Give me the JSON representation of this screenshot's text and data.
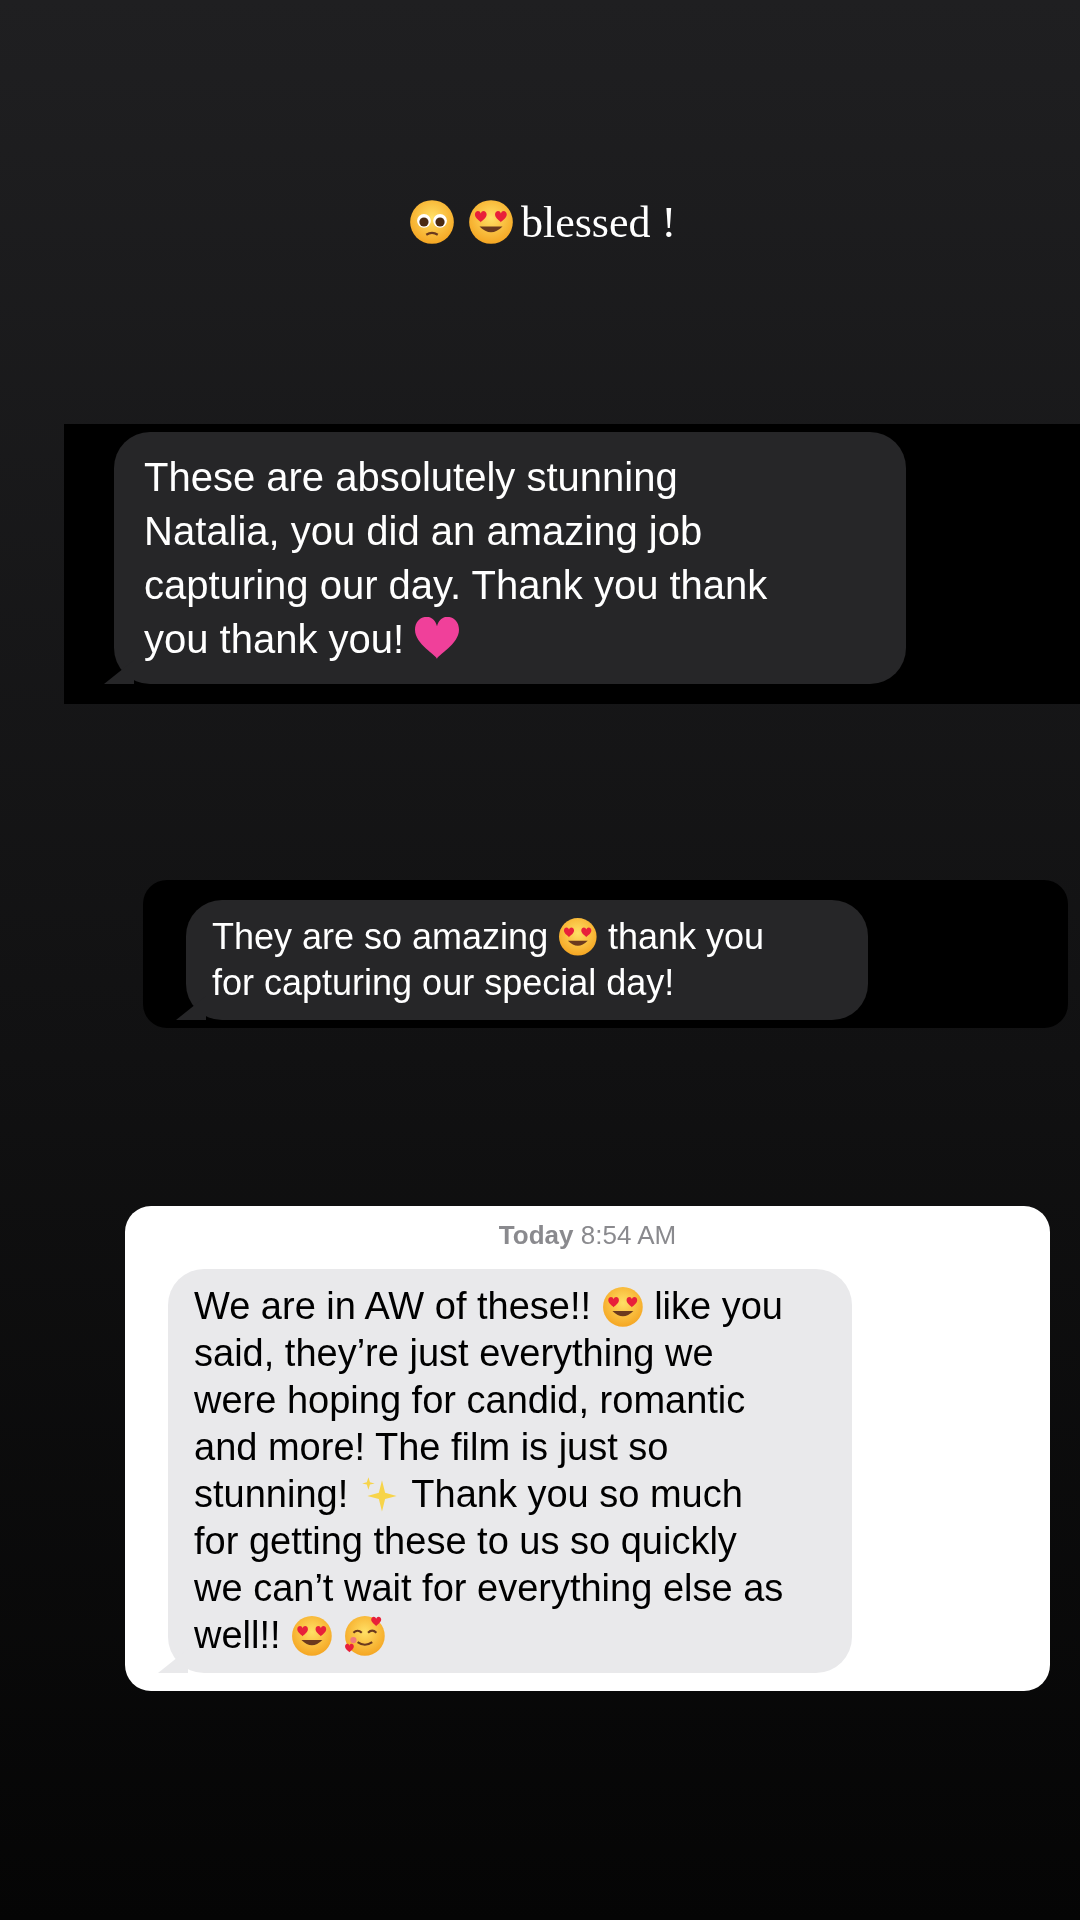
{
  "caption": [
    {
      "kind": "pleading"
    },
    {
      "kind": "heart_eyes"
    },
    {
      "kind": "text",
      "text": "blessed !"
    }
  ],
  "cards": [
    {
      "kind": "dark",
      "lines": [
        [
          {
            "kind": "text",
            "text": "These are absolutely stunning"
          }
        ],
        [
          {
            "kind": "text",
            "text": "Natalia, you did an amazing job"
          }
        ],
        [
          {
            "kind": "text",
            "text": "capturing our day. Thank you thank"
          }
        ],
        [
          {
            "kind": "text",
            "text": "you thank you!"
          },
          {
            "kind": "heart"
          }
        ]
      ]
    },
    {
      "kind": "dark_small",
      "lines": [
        [
          {
            "kind": "text",
            "text": "They are so amazing"
          },
          {
            "kind": "heart_eyes"
          },
          {
            "kind": "text",
            "text": "thank you"
          }
        ],
        [
          {
            "kind": "text",
            "text": "for capturing our special day!"
          }
        ]
      ]
    },
    {
      "kind": "light",
      "timestamp_day": "Today",
      "timestamp_time": "8:54 AM",
      "lines": [
        [
          {
            "kind": "text",
            "text": "We are in AW of these!!"
          },
          {
            "kind": "heart_eyes"
          },
          {
            "kind": "text",
            "text": "like you"
          }
        ],
        [
          {
            "kind": "text",
            "text": "said, they’re just everything we"
          }
        ],
        [
          {
            "kind": "text",
            "text": "were hoping for candid, romantic"
          }
        ],
        [
          {
            "kind": "text",
            "text": "and more! The film is just so"
          }
        ],
        [
          {
            "kind": "text",
            "text": "stunning!"
          },
          {
            "kind": "sparkles"
          },
          {
            "kind": "text",
            "text": "Thank you so much"
          }
        ],
        [
          {
            "kind": "text",
            "text": "for getting these to us so quickly"
          }
        ],
        [
          {
            "kind": "text",
            "text": "we can’t wait for everything else as"
          }
        ],
        [
          {
            "kind": "text",
            "text": "well!!"
          },
          {
            "kind": "heart_eyes"
          },
          {
            "kind": "smiling_hearts"
          }
        ]
      ]
    }
  ]
}
